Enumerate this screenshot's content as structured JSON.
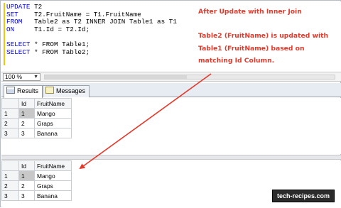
{
  "editor": {
    "lines": [
      {
        "a": "UPDATE",
        "b": " T2"
      },
      {
        "a": "SET",
        "b": "    T2.FruitName = T1.FruitName"
      },
      {
        "a": "FROM",
        "b": "   Table2 as T2 INNER JOIN Table1 as T1"
      },
      {
        "a": "ON",
        "b": "     T1.Id = T2.Id;"
      },
      {
        "a": "SELECT",
        "b": " * FROM Table1;"
      },
      {
        "a": "SELECT",
        "b": " * FROM Table2;"
      }
    ]
  },
  "annotation": {
    "title": "After Update with Inner Join",
    "lines": [
      "Table2 (FruitName) is updated with",
      "Table1 (FruitName) based on",
      "matching Id Column."
    ],
    "color": "#e33a2c"
  },
  "zoom": {
    "value": "100 %"
  },
  "tabs": [
    {
      "label": "Results",
      "icon": "grid-icon"
    },
    {
      "label": "Messages",
      "icon": "message-icon"
    }
  ],
  "grid1": {
    "headers": [
      "Id",
      "FruitName"
    ],
    "rows": [
      {
        "n": "1",
        "id": "1",
        "fruit": "Mango"
      },
      {
        "n": "2",
        "id": "2",
        "fruit": "Graps"
      },
      {
        "n": "3",
        "id": "3",
        "fruit": "Banana"
      }
    ]
  },
  "grid2": {
    "headers": [
      "Id",
      "FruitName"
    ],
    "rows": [
      {
        "n": "1",
        "id": "1",
        "fruit": "Mango"
      },
      {
        "n": "2",
        "id": "2",
        "fruit": "Graps"
      },
      {
        "n": "3",
        "id": "3",
        "fruit": "Banana"
      }
    ]
  },
  "watermark": "tech-recipes.com"
}
